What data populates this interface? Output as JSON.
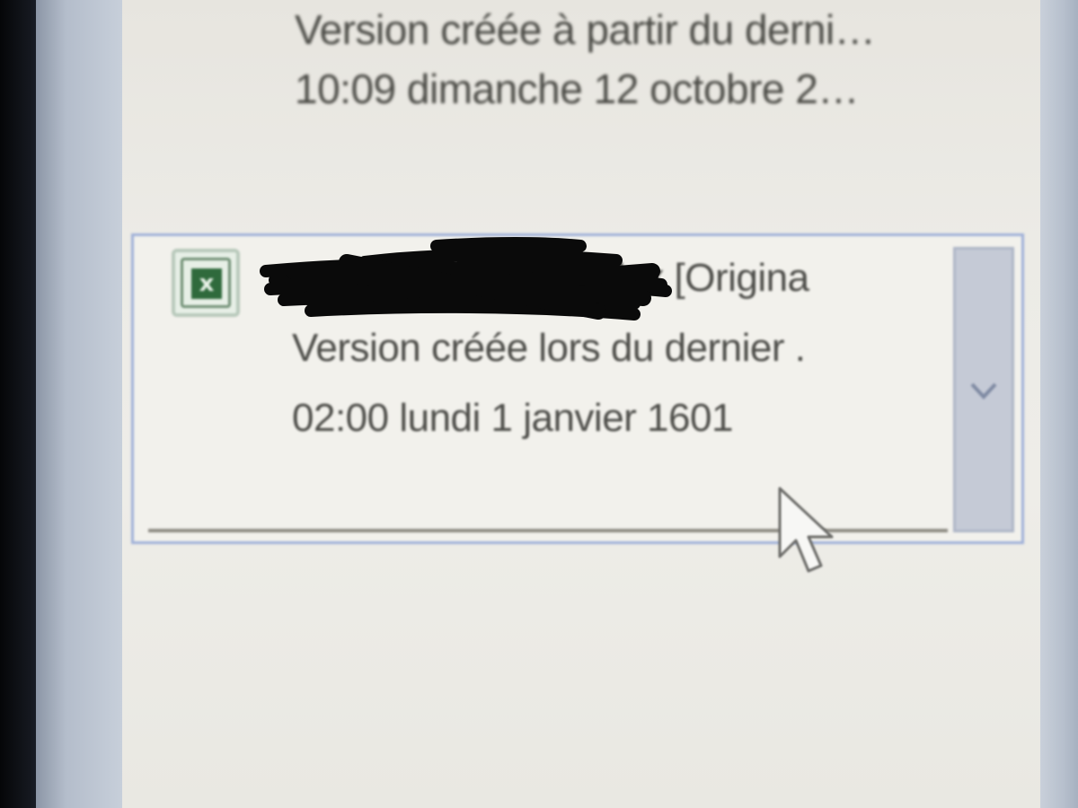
{
  "previous_version": {
    "description": "Version créée à partir du derni…",
    "timestamp": "10:09 dimanche 12 octobre 2…"
  },
  "selected_version": {
    "file_name": "xlsx  [Origina",
    "description": "Version créée lors du dernier .",
    "timestamp": "02:00 lundi 1 janvier 1601",
    "icon": "excel-file-icon",
    "icon_glyph": "x"
  },
  "colors": {
    "selection_border": "#9fb0d8",
    "panel_background": "#ecebe6",
    "text": "#4e4e4a",
    "excel_green": "#2f6a3c"
  },
  "scroll_button": {
    "icon": "chevron-down-icon"
  }
}
